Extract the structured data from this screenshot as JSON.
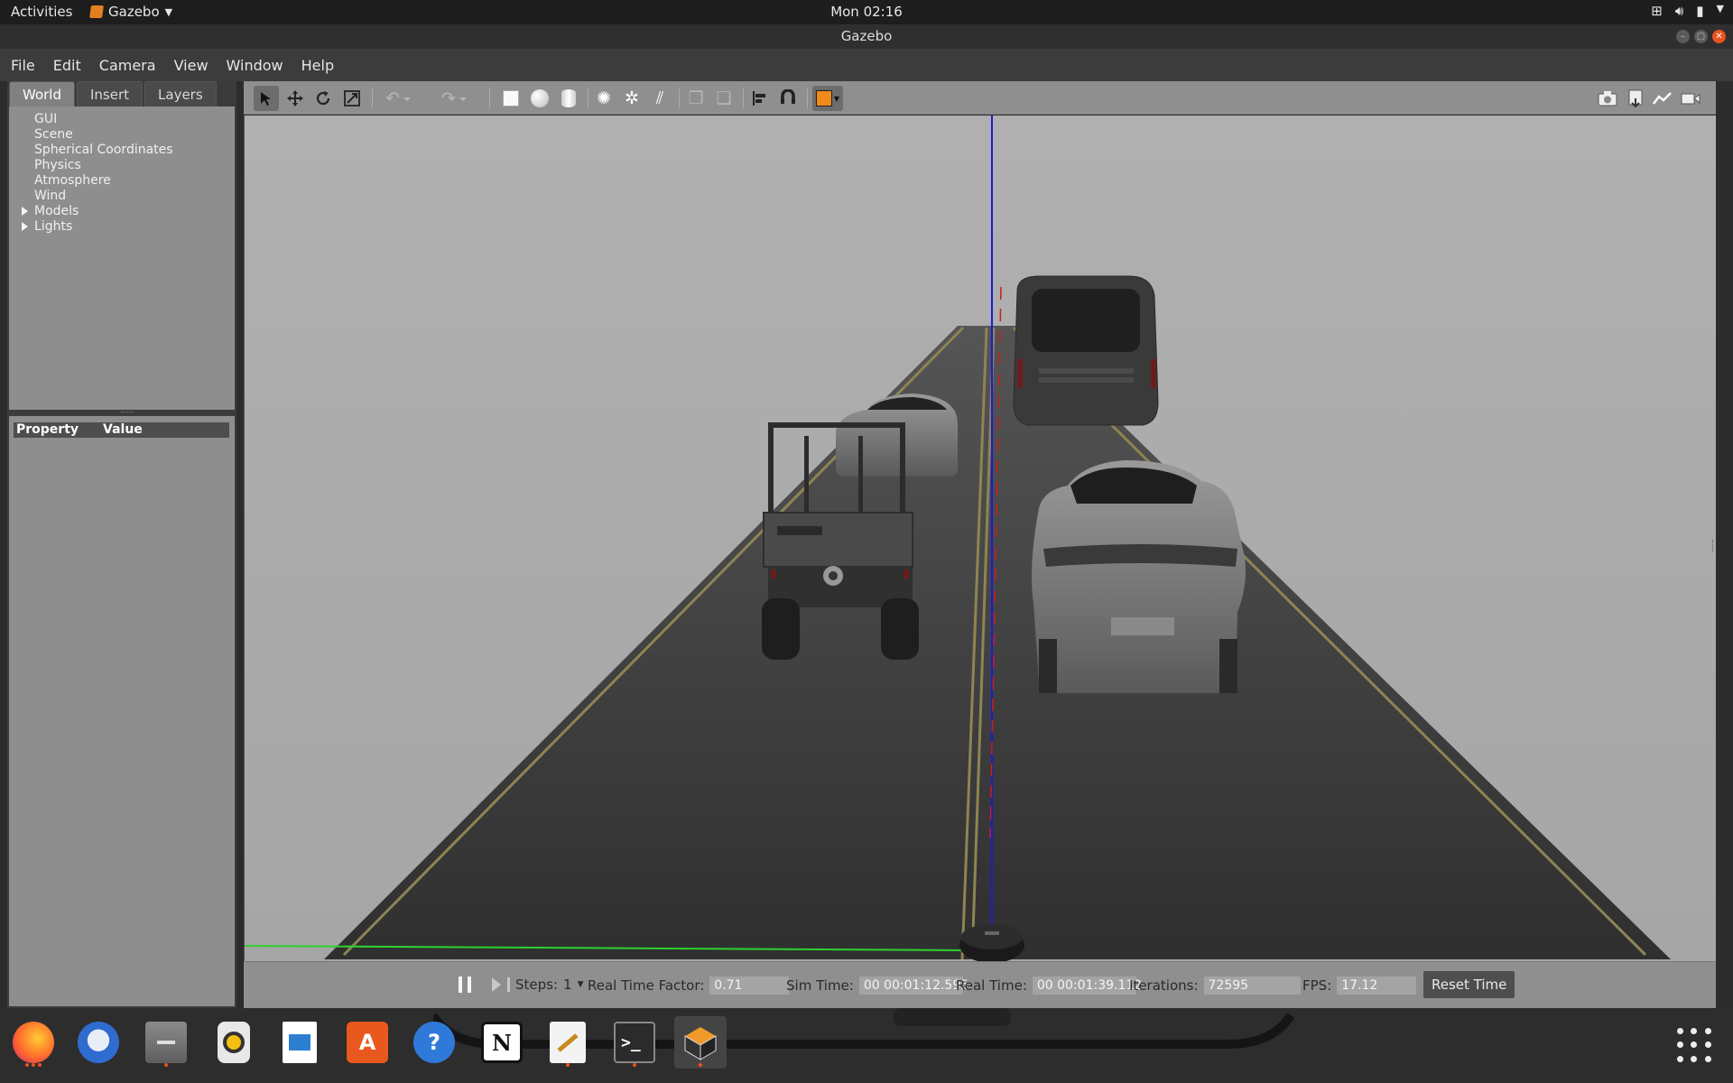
{
  "topbar": {
    "activities": "Activities",
    "app_name": "Gazebo",
    "clock": "Mon 02:16"
  },
  "window": {
    "title": "Gazebo"
  },
  "menu": [
    "File",
    "Edit",
    "Camera",
    "View",
    "Window",
    "Help"
  ],
  "left_panel": {
    "tabs": [
      "World",
      "Insert",
      "Layers"
    ],
    "active_tab": "World",
    "tree": [
      {
        "label": "GUI",
        "expandable": false
      },
      {
        "label": "Scene",
        "expandable": false
      },
      {
        "label": "Spherical Coordinates",
        "expandable": false
      },
      {
        "label": "Physics",
        "expandable": false
      },
      {
        "label": "Atmosphere",
        "expandable": false
      },
      {
        "label": "Wind",
        "expandable": false
      },
      {
        "label": "Models",
        "expandable": true
      },
      {
        "label": "Lights",
        "expandable": true
      }
    ],
    "property_header": {
      "property": "Property",
      "value": "Value"
    }
  },
  "toolbar": {
    "tools": [
      "select-mode",
      "translate-mode",
      "rotate-mode",
      "scale-mode",
      "undo",
      "redo",
      "box",
      "sphere",
      "cylinder",
      "point-light",
      "spot-light",
      "directional-light",
      "copy",
      "paste",
      "align",
      "snap",
      "view-angle"
    ],
    "right_tools": [
      "screenshot",
      "log",
      "plot",
      "record-video"
    ]
  },
  "simbar": {
    "steps_label": "Steps:",
    "steps_value": "1",
    "rtf_label": "Real Time Factor:",
    "rtf_value": "0.71",
    "sim_time_label": "Sim Time:",
    "sim_time_value": "00 00:01:12.595",
    "real_time_label": "Real Time:",
    "real_time_value": "00 00:01:39.112",
    "iterations_label": "Iterations:",
    "iterations_value": "72595",
    "fps_label": "FPS:",
    "fps_value": "17.12",
    "reset_label": "Reset Time"
  },
  "dock": {
    "apps": [
      "firefox",
      "thunderbird",
      "files",
      "rhythmbox",
      "writer",
      "software",
      "help",
      "notion",
      "text-editor",
      "terminal",
      "gazebo"
    ],
    "notion_letter": "N"
  }
}
